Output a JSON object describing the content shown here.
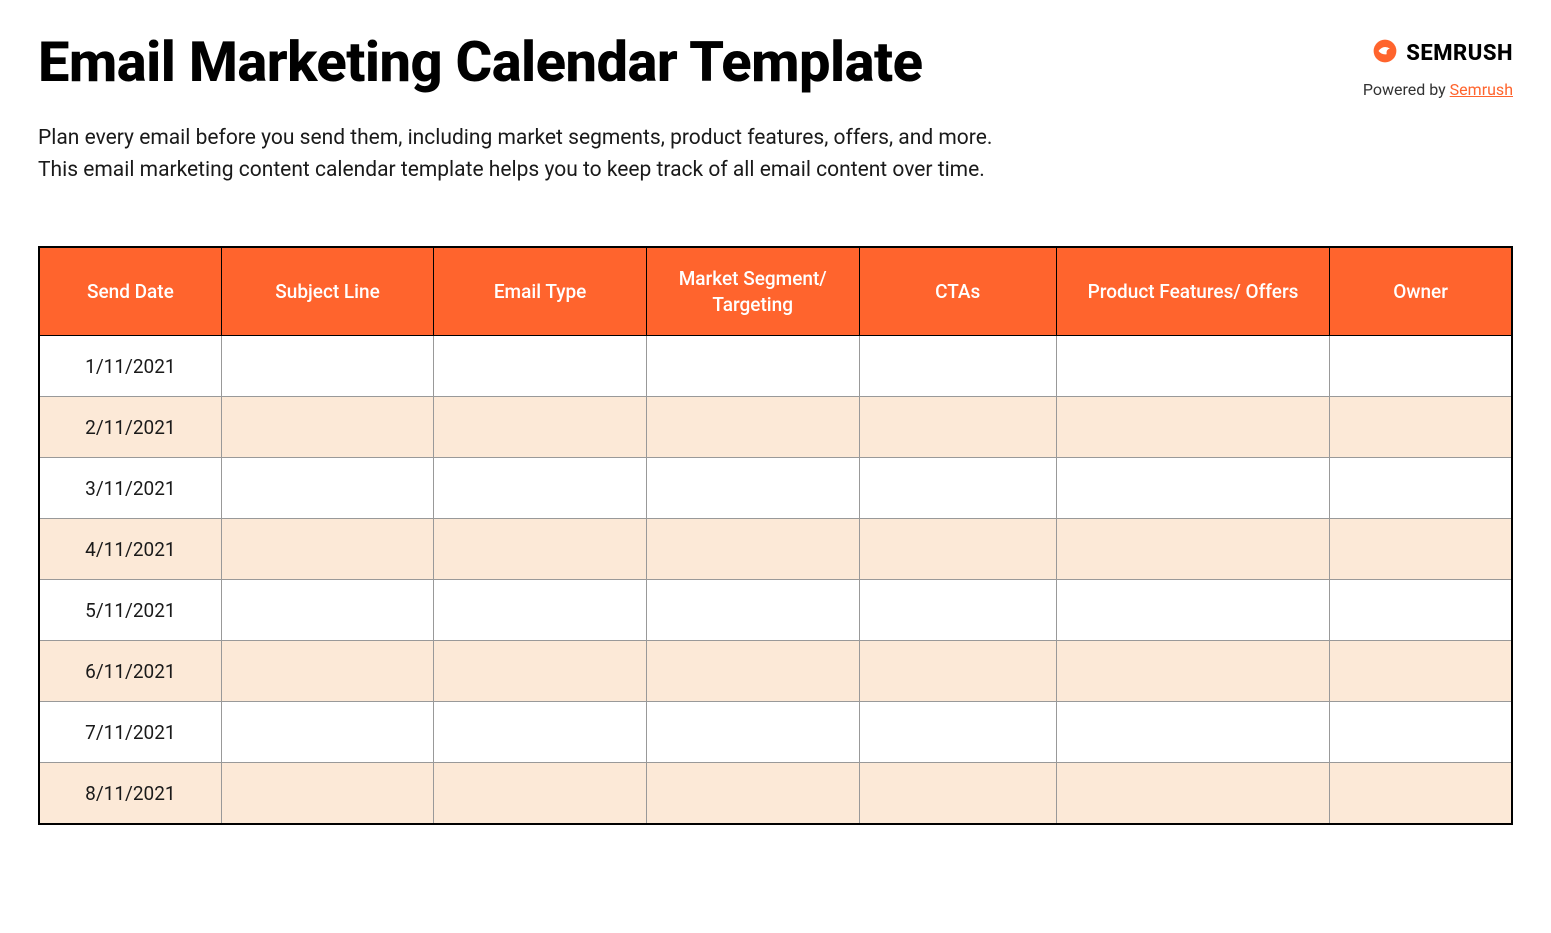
{
  "header": {
    "title": "Email Marketing Calendar Template",
    "brand_name": "SEMRUSH",
    "powered_by_prefix": "Powered by ",
    "powered_by_link_text": "Semrush"
  },
  "description": "Plan every email before you send them, including market segments, product features, offers, and more.\nThis email marketing content calendar template helps you to keep track of all email content over time.",
  "table": {
    "headers": [
      "Send Date",
      "Subject Line",
      "Email Type",
      "Market Segment/ Targeting",
      "CTAs",
      "Product Features/ Offers",
      "Owner"
    ],
    "rows": [
      {
        "send_date": "1/11/2021",
        "subject_line": "",
        "email_type": "",
        "market_segment": "",
        "ctas": "",
        "product_features": "",
        "owner": ""
      },
      {
        "send_date": "2/11/2021",
        "subject_line": "",
        "email_type": "",
        "market_segment": "",
        "ctas": "",
        "product_features": "",
        "owner": ""
      },
      {
        "send_date": "3/11/2021",
        "subject_line": "",
        "email_type": "",
        "market_segment": "",
        "ctas": "",
        "product_features": "",
        "owner": ""
      },
      {
        "send_date": "4/11/2021",
        "subject_line": "",
        "email_type": "",
        "market_segment": "",
        "ctas": "",
        "product_features": "",
        "owner": ""
      },
      {
        "send_date": "5/11/2021",
        "subject_line": "",
        "email_type": "",
        "market_segment": "",
        "ctas": "",
        "product_features": "",
        "owner": ""
      },
      {
        "send_date": "6/11/2021",
        "subject_line": "",
        "email_type": "",
        "market_segment": "",
        "ctas": "",
        "product_features": "",
        "owner": ""
      },
      {
        "send_date": "7/11/2021",
        "subject_line": "",
        "email_type": "",
        "market_segment": "",
        "ctas": "",
        "product_features": "",
        "owner": ""
      },
      {
        "send_date": "8/11/2021",
        "subject_line": "",
        "email_type": "",
        "market_segment": "",
        "ctas": "",
        "product_features": "",
        "owner": ""
      }
    ]
  }
}
